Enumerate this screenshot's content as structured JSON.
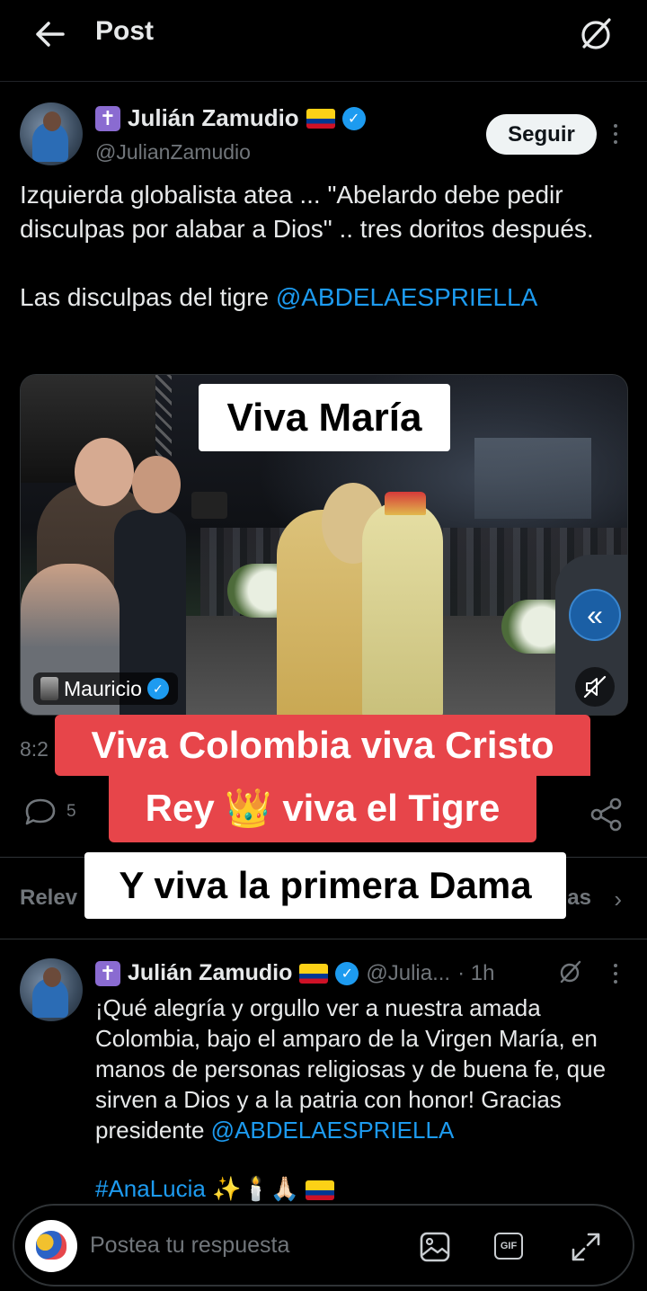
{
  "header": {
    "title": "Post"
  },
  "post": {
    "author": {
      "name": "Julián Zamudio",
      "handle": "@JulianZamudio"
    },
    "follow_label": "Seguir",
    "text": "Izquierda globalista atea ... \"Abelardo debe pedir disculpas por alabar a Dios\" .. tres doritos después.\n\nLas disculpas del tigre ",
    "mention": "@ABDELAESPRIELLA",
    "media": {
      "uploader": "Mauricio",
      "rewind_icon": "«"
    },
    "timestamp_partial": "8:2",
    "reply_count": "5"
  },
  "relevant": {
    "left_text": "Relev",
    "right_text": "as",
    "chevron": "›"
  },
  "overlays": {
    "top": "Viva María",
    "red_line1": "Viva Colombia viva Cristo",
    "red_line2": "Rey 👑 viva el Tigre",
    "bottom": "Y viva la primera Dama"
  },
  "reply": {
    "author": {
      "name": "Julián Zamudio",
      "handle": "@Julia...",
      "time": "· 1h"
    },
    "text": "¡Qué alegría y orgullo ver a nuestra amada Colombia, bajo el amparo de la Virgen María, en manos de personas religiosas y de buena fe, que sirven a Dios y a la patria con honor! Gracias presidente ",
    "mention": "@ABDELAESPRIELLA",
    "tags": "#AnaLucia ✨🕯️🙏🏻"
  },
  "composer": {
    "placeholder": "Postea tu respuesta",
    "gif_label": "GIF"
  },
  "colors": {
    "link": "#1d9bf0",
    "caption_red": "#e7454a",
    "background": "#000000"
  }
}
